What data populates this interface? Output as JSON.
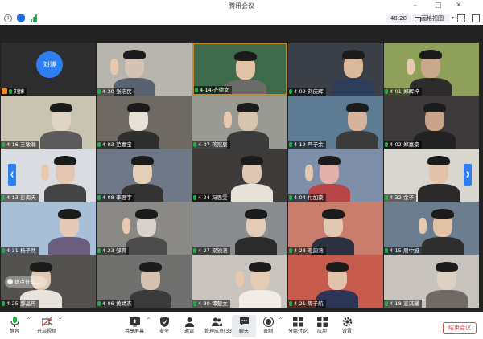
{
  "app": {
    "title": "腾讯会议"
  },
  "toolbar": {
    "timer": "48:28",
    "view_label": "画格视图"
  },
  "self_tile": {
    "avatar_text": "刘博",
    "name": "刘博"
  },
  "participants": [
    "4-20-张浩民",
    "4-14-齐德文",
    "4-09-刘庆辉",
    "4-01-郑辉梓",
    "4-16-王敏瀚",
    "4-03-范嘉宝",
    "4-07-蒋冠辰",
    "4-19-严子余",
    "4-02-郑嘉豪",
    "4-13-彭海天",
    "4-08-李思宇",
    "4-24-冯思雯",
    "4-04-付加豪",
    "4-32-余子",
    "4-31-杨子然",
    "4-23-邹爽",
    "4-27-梁锐涵",
    "4-28-毛韵涵",
    "4-15-屈中旭",
    "4-25-郝晶丹",
    "4-06-黄靖杰",
    "4-30-谭楚文",
    "4-21-周子航",
    "4-18-宣淇耀"
  ],
  "chat_bubble": "说点什么...",
  "controls": {
    "mute": "静音",
    "video": "开启视频",
    "share": "共享屏幕",
    "security": "安全",
    "invite": "邀请",
    "members": "管理成员(33)",
    "chat": "聊天",
    "record": "录制",
    "breakout": "分组讨论",
    "apps": "应用",
    "settings": "设置",
    "end": "结束会议"
  },
  "colors": {
    "accent": "#2d7ff0",
    "danger": "#e14b4b",
    "mic_on": "#22b04a"
  }
}
